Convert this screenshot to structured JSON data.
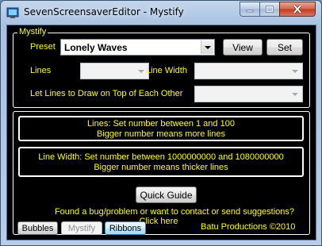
{
  "window": {
    "title": "SevenScreensaverEditor - Mystify"
  },
  "group": {
    "legend": "Mystify"
  },
  "preset": {
    "label": "Preset",
    "value": "Lonely Waves",
    "view_label": "View",
    "set_label": "Set"
  },
  "lines": {
    "label": "Lines",
    "value": ""
  },
  "line_width": {
    "label": "Line Width",
    "value": ""
  },
  "overlap": {
    "label": "Let Lines to Draw on Top of Each Other",
    "value": ""
  },
  "info": {
    "lines_line1": "Lines: Set number between 1 and 100",
    "lines_line2": "Bigger number means more lines",
    "width_line1": "Line Width: Set number between 1000000000 and 1080000000",
    "width_line2": "Bigger number means thicker lines"
  },
  "quick_guide_label": "Quick Guide",
  "footer": {
    "bug_line1": "Found a bug/problem or want to contact or send suggestions?",
    "bug_line2": "Click here",
    "credit": "Batu Productions ©2010"
  },
  "tabs": [
    {
      "label": "Bubbles"
    },
    {
      "label": "Mystify"
    },
    {
      "label": "Ribbons"
    }
  ],
  "colors": {
    "accent_text": "#ffff00",
    "background": "#000000",
    "chrome": "#b8cde7"
  }
}
